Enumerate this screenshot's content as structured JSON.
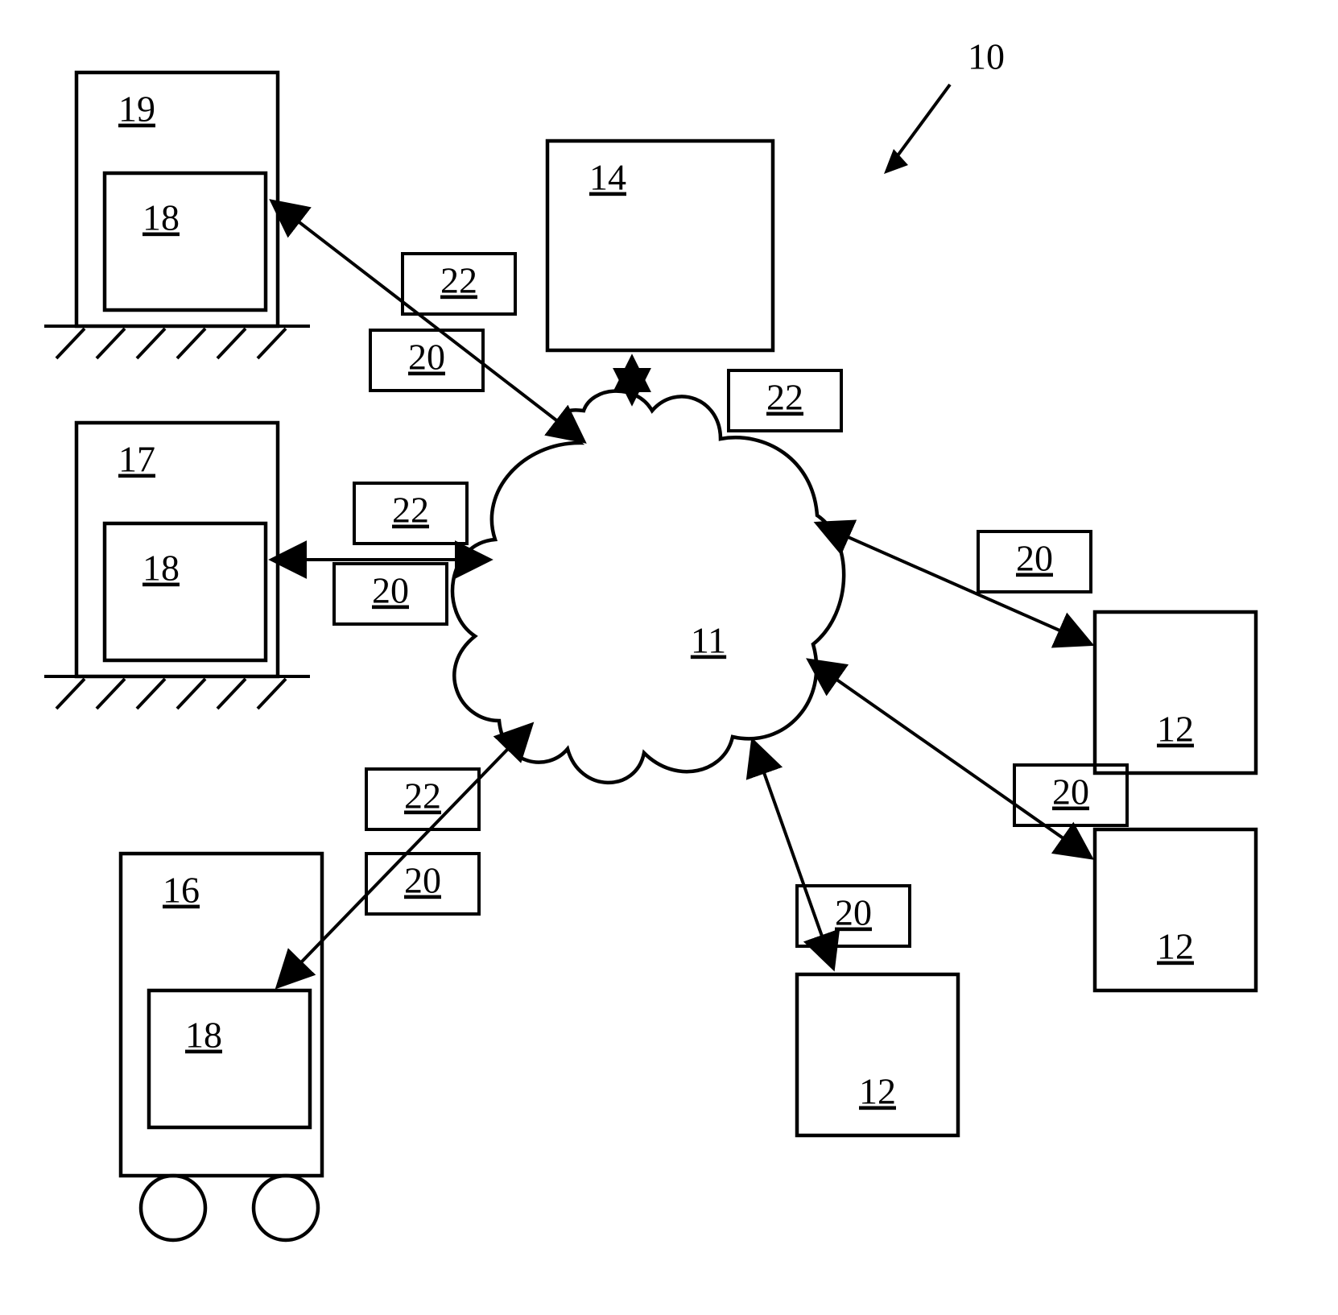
{
  "diagram": {
    "title_ref": "10",
    "cloud_ref": "11",
    "server_ref": "14",
    "clients": {
      "ref": "12"
    },
    "devices": {
      "top_building_ref": "19",
      "mid_building_ref": "17",
      "cart_ref": "16",
      "inner_ref": "18"
    },
    "link_labels": {
      "a": "20",
      "b": "22"
    }
  }
}
